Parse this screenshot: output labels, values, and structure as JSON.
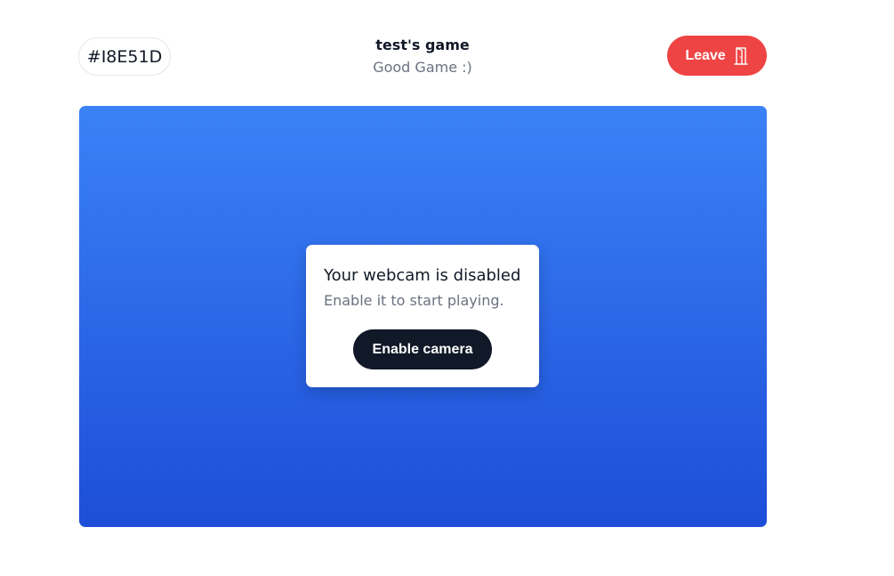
{
  "header": {
    "room_code": "#I8E51D",
    "game_title": "test's game",
    "game_subtitle": "Good Game :)",
    "leave_label": "Leave"
  },
  "webcam_card": {
    "title": "Your webcam is disabled",
    "text": "Enable it to start playing.",
    "button_label": "Enable camera"
  },
  "icons": {
    "leave": "door-exit-icon"
  },
  "colors": {
    "leave_button": "#ef4444",
    "video_gradient_top": "#3b82f6",
    "video_gradient_bottom": "#1d4ed8",
    "enable_button": "#111827"
  }
}
